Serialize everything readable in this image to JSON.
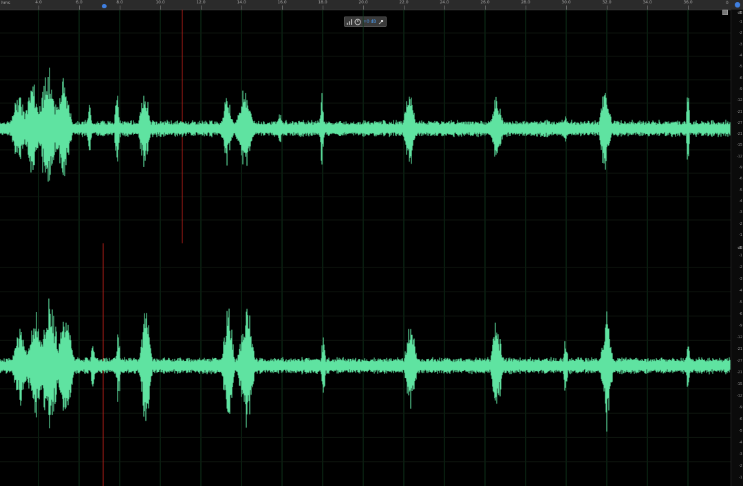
{
  "ruler": {
    "unit_label": "hms",
    "end_label": "0",
    "ticks": [
      "4.0",
      "6.0",
      "8.0",
      "10.0",
      "12.0",
      "14.0",
      "16.0",
      "18.0",
      "20.0",
      "22.0",
      "24.0",
      "26.0",
      "28.0",
      "30.0",
      "32.0",
      "34.0",
      "36.0"
    ]
  },
  "hud": {
    "gain_label": "+0 dB"
  },
  "scale": {
    "unit": "dB",
    "labels": [
      "-1",
      "-2",
      "-3",
      "-4",
      "-5",
      "-6",
      "-9",
      "-12",
      "-21",
      "-27",
      "-21",
      "-15",
      "-12",
      "-9",
      "-6",
      "-5",
      "-4",
      "-3",
      "-2",
      "-1"
    ]
  },
  "colors": {
    "waveform": "#5fe3a1",
    "background": "#000000",
    "grid": "#0f3a1e",
    "marker": "#c2201a",
    "playhead": "#3f7fe0"
  },
  "icons": {
    "meter": "signal-bars-icon",
    "knob": "gain-knob-icon",
    "pin": "pin-icon",
    "settings": "settings-icon",
    "corner": "corner-square-icon"
  }
}
